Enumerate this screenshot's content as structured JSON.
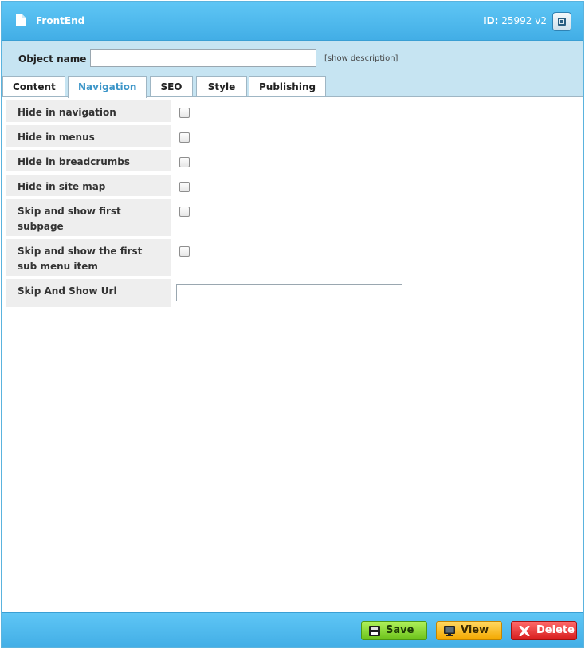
{
  "window": {
    "title": "FrontEnd",
    "id_label": "ID:",
    "id_value": "25992 v2"
  },
  "object_name": {
    "label": "Object name",
    "value": "",
    "show_description": "[show description]"
  },
  "tabs": [
    {
      "label": "Content",
      "active": false
    },
    {
      "label": "Navigation",
      "active": true
    },
    {
      "label": "SEO",
      "active": false
    },
    {
      "label": "Style",
      "active": false
    },
    {
      "label": "Publishing",
      "active": false
    }
  ],
  "fields": [
    {
      "label": "Hide in navigation",
      "type": "checkbox",
      "checked": false
    },
    {
      "label": "Hide in menus",
      "type": "checkbox",
      "checked": false
    },
    {
      "label": "Hide in breadcrumbs",
      "type": "checkbox",
      "checked": false
    },
    {
      "label": "Hide in site map",
      "type": "checkbox",
      "checked": false
    },
    {
      "label": "Skip and show first subpage",
      "type": "checkbox",
      "checked": false
    },
    {
      "label": "Skip and show the first sub menu item",
      "type": "checkbox",
      "checked": false
    },
    {
      "label": "Skip And Show Url",
      "type": "text",
      "value": ""
    }
  ],
  "footer": {
    "save_label": "Save",
    "view_label": "View",
    "delete_label": "Delete"
  },
  "colors": {
    "header_blue": "#4db8ec",
    "name_strip": "#c6e4f2",
    "active_tab_text": "#3b95c8",
    "save_green": "#8ad93a",
    "view_orange": "#f9be2a",
    "delete_red": "#e83333"
  }
}
